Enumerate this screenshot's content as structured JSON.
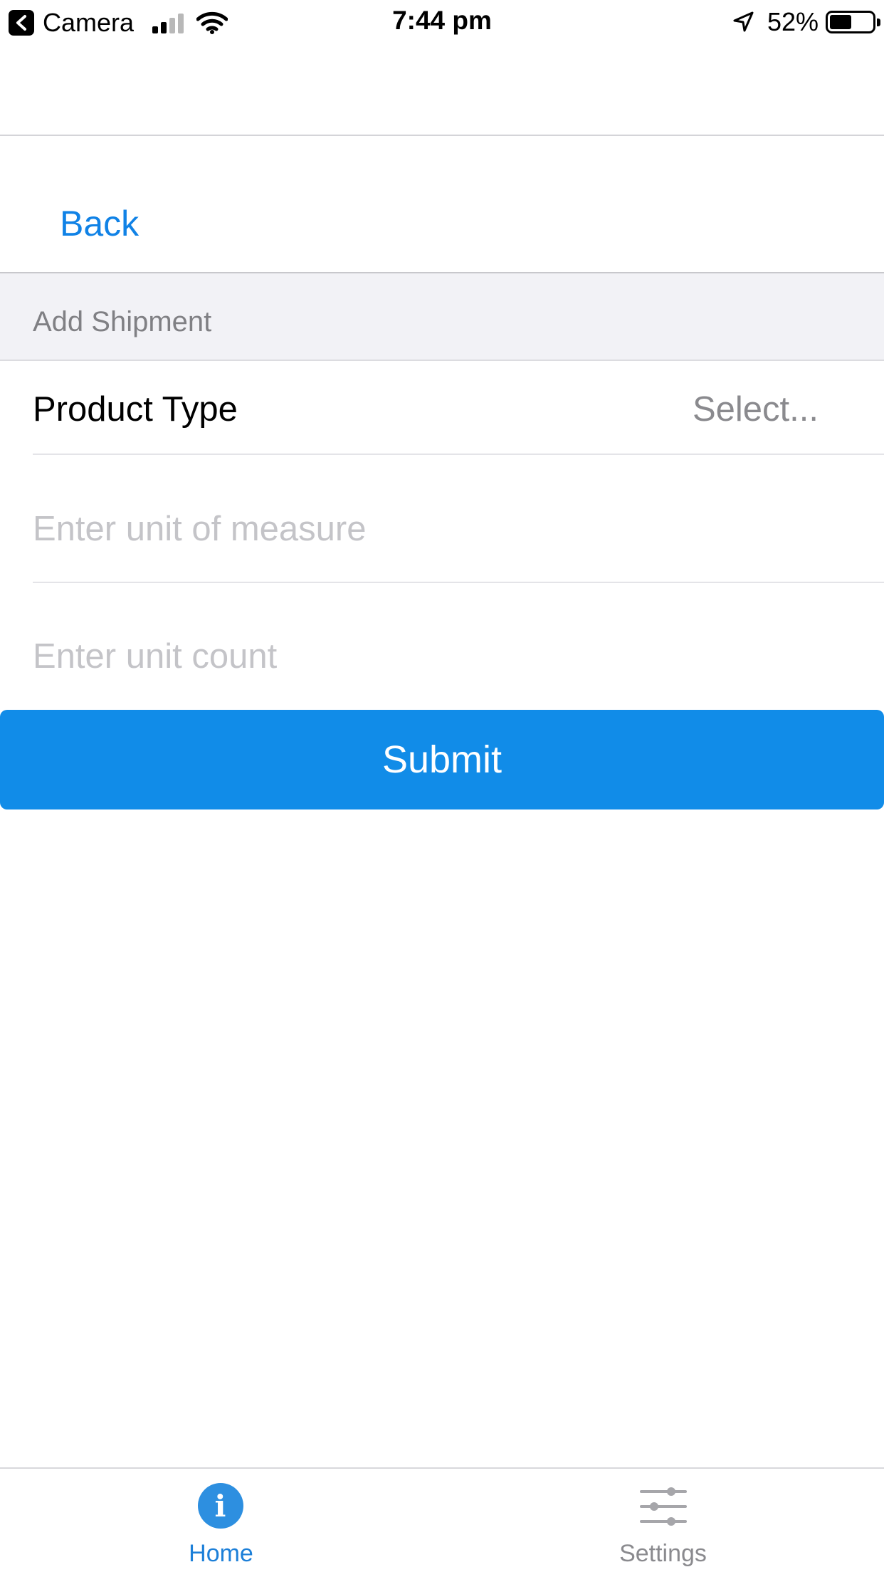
{
  "status_bar": {
    "app_label": "Camera",
    "time": "7:44 pm",
    "battery_percent_text": "52%",
    "battery_level": 0.52
  },
  "nav": {
    "back_label": "Back"
  },
  "form": {
    "section_title": "Add Shipment",
    "product_type_label": "Product Type",
    "product_type_value": "Select...",
    "unit_of_measure": {
      "value": "",
      "placeholder": "Enter unit of measure"
    },
    "unit_count": {
      "value": "",
      "placeholder": "Enter unit count"
    },
    "submit_label": "Submit"
  },
  "tab_bar": {
    "tabs": [
      {
        "label": "Home",
        "icon": "info-icon",
        "active": true
      },
      {
        "label": "Settings",
        "icon": "sliders-icon",
        "active": false
      }
    ]
  },
  "colors": {
    "accent": "#1082e6",
    "submit_bg": "#118ce8",
    "section_bg": "#f2f2f6",
    "placeholder": "#c4c4c8"
  }
}
